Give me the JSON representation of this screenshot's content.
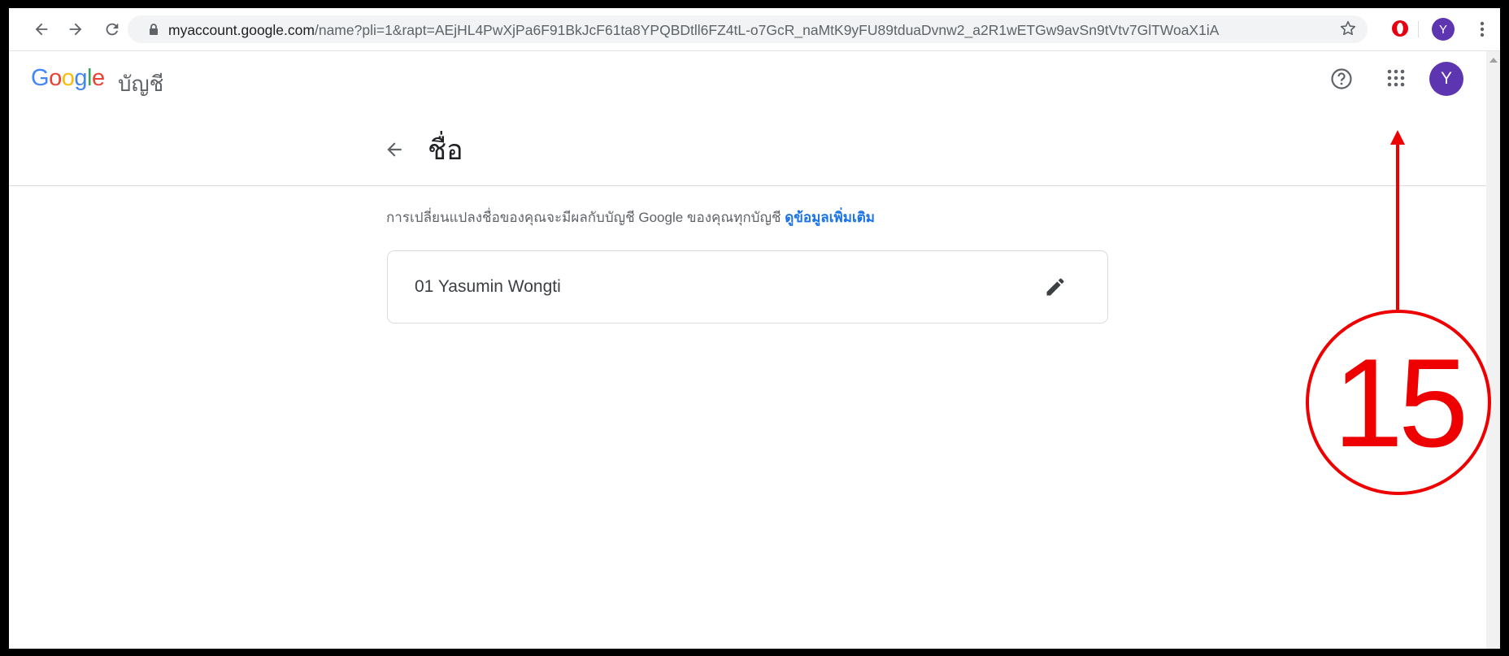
{
  "browser": {
    "url_host": "myaccount.google.com",
    "url_path": "/name?pli=1&rapt=AEjHL4PwXjPa6F91BkJcF61ta8YPQBDtll6FZ4tL-o7GcR_naMtK9yFU89tduaDvnw2_a2R1wETGw9avSn9tVtv7GlTWoaX1iA",
    "profile_initial": "Y",
    "icons": [
      "back-icon",
      "forward-icon",
      "reload-icon",
      "lock-icon",
      "star-icon",
      "opera-icon",
      "menu-icon"
    ]
  },
  "header": {
    "logo": {
      "G": "G",
      "o1": "o",
      "o2": "o",
      "g": "g",
      "l": "l",
      "e": "e"
    },
    "product": "บัญชี",
    "avatar_initial": "Y",
    "colors": {
      "blue": "#4285f4",
      "red": "#ea4335",
      "yellow": "#fbbc05",
      "green": "#34a853",
      "avatar": "#5e35b1"
    }
  },
  "page": {
    "title": "ชื่อ",
    "info_text": "การเปลี่ยนแปลงชื่อของคุณจะมีผลกับบัญชี Google ของคุณทุกบัญชี",
    "learn_more": "ดูข้อมูลเพิ่มเติม",
    "name_value": "01 Yasumin Wongti"
  },
  "annotation": {
    "number": "15",
    "color": "#ee0000"
  }
}
